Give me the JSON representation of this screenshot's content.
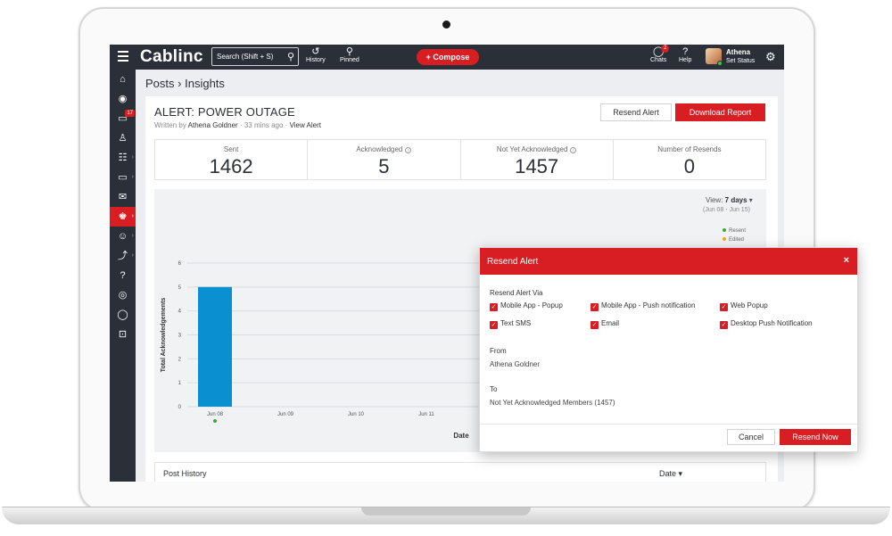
{
  "app": {
    "brand": "Cablinc",
    "search_placeholder": "Search (Shift + S)",
    "history_label": "History",
    "pinned_label": "Pinned",
    "compose_label": "+ Compose",
    "chats_label": "Chats",
    "chats_badge": "2",
    "help_label": "Help",
    "user_name": "Athena",
    "user_status": "Set Status",
    "notification_badge": "17"
  },
  "breadcrumb": {
    "parent": "Posts",
    "separator": "›",
    "current": "Insights"
  },
  "alert": {
    "title": "ALERT: POWER OUTAGE",
    "written_by": "Written by",
    "author": "Athena Goldner",
    "time": "33 mins ago",
    "view_alert": "View Alert",
    "resend_button": "Resend Alert",
    "download_button": "Download Report"
  },
  "stats": [
    {
      "label": "Sent",
      "value": "1462"
    },
    {
      "label": "Acknowledged",
      "value": "5"
    },
    {
      "label": "Not Yet Acknowledged",
      "value": "1457"
    },
    {
      "label": "Number of Resends",
      "value": "0"
    }
  ],
  "view": {
    "label": "View:",
    "value": "7 days",
    "range": "(Jun 08 - Jun 15)"
  },
  "legend": [
    {
      "name": "Resent",
      "color": "#3aa935"
    },
    {
      "name": "Edited",
      "color": "#f0a81a"
    }
  ],
  "chart_data": {
    "type": "bar",
    "ylabel": "Total Acknowledgements",
    "xlabel": "Date",
    "ylim": [
      0,
      6
    ],
    "yticks": [
      0,
      1,
      2,
      3,
      4,
      5,
      6
    ],
    "categories": [
      "Jun 08",
      "Jun 09",
      "Jun 10",
      "Jun 11"
    ],
    "values": [
      5,
      0,
      0,
      0
    ],
    "bar_color": "#0a8fd0",
    "marker_color": "#3aa935"
  },
  "history": {
    "title": "Post History",
    "date_col": "Date ▾"
  },
  "modal": {
    "title": "Resend Alert",
    "close": "×",
    "via_label": "Resend Alert Via",
    "options": [
      {
        "label": "Mobile App - Popup",
        "checked": true
      },
      {
        "label": "Mobile App - Push notification",
        "checked": true
      },
      {
        "label": "Web Popup",
        "checked": true
      },
      {
        "label": "Text SMS",
        "checked": true
      },
      {
        "label": "Email",
        "checked": true
      },
      {
        "label": "Desktop Push Notification",
        "checked": true
      }
    ],
    "from_label": "From",
    "from_value": "Athena Goldner",
    "to_label": "To",
    "to_value": "Not Yet Acknowledged Members (1457)",
    "cancel_button": "Cancel",
    "resend_button": "Resend Now"
  },
  "colors": {
    "accent": "#d81e22",
    "dark": "#2b2f38"
  }
}
